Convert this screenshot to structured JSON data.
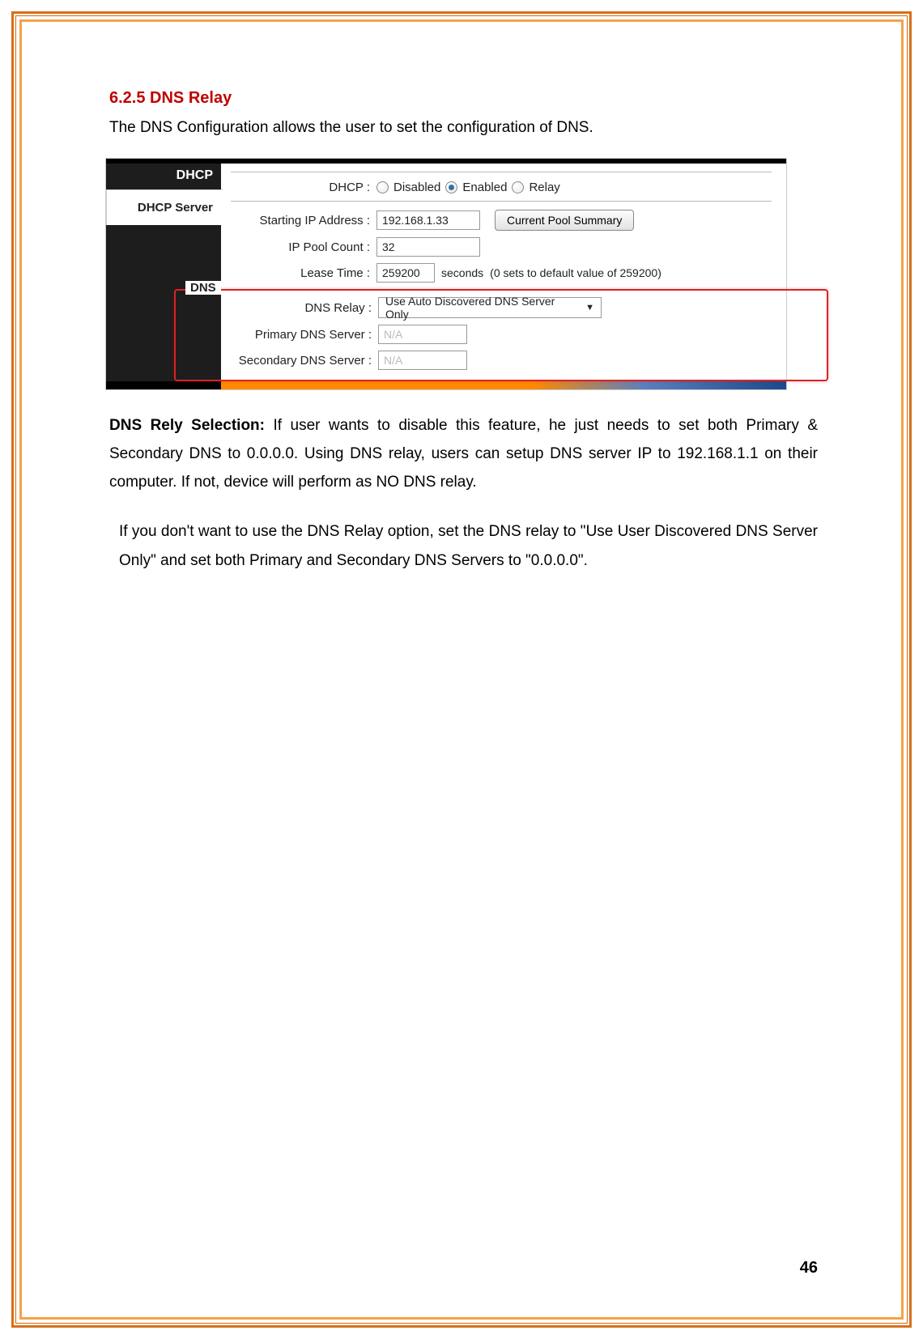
{
  "section": {
    "title": "6.2.5 DNS Relay",
    "intro": "The DNS Configuration allows the user to set the configuration of DNS."
  },
  "shot": {
    "sidebar": {
      "dhcp_tab": "DHCP",
      "dhcp_server_tab": "DHCP Server"
    },
    "dhcp": {
      "label": "DHCP :",
      "opt_disabled": "Disabled",
      "opt_enabled": "Enabled",
      "opt_relay": "Relay",
      "start_ip_lbl": "Starting IP Address :",
      "start_ip_val": "192.168.1.33",
      "pool_btn": "Current Pool Summary",
      "pool_count_lbl": "IP Pool Count :",
      "pool_count_val": "32",
      "lease_lbl": "Lease Time :",
      "lease_val": "259200",
      "lease_unit": "seconds",
      "lease_note": "(0 sets to default value of 259200)"
    },
    "dns": {
      "legend": "DNS",
      "relay_lbl": "DNS Relay :",
      "relay_sel": "Use Auto Discovered DNS Server Only",
      "primary_lbl": "Primary DNS Server  :",
      "primary_val": "N/A",
      "secondary_lbl": "Secondary DNS Server :",
      "secondary_val": "N/A"
    }
  },
  "para1": {
    "lead_bold": "DNS Rely Selection:",
    "body": " If user wants to disable this feature, he just needs to set both Primary & Secondary DNS to 0.0.0.0. Using DNS relay, users can setup DNS server IP to 192.168.1.1 on their computer. If not, device will perform as NO DNS relay."
  },
  "para2": {
    "p1": "If you don't want to use the DNS Relay option, set the DNS relay to \"",
    "b1": "Use User Discovered DNS Server Only",
    "p2": "\" and set both Primary and Secondary DNS Servers to \"",
    "b2": "0.0.0.0",
    "p3": "\"."
  },
  "page_number": "46"
}
